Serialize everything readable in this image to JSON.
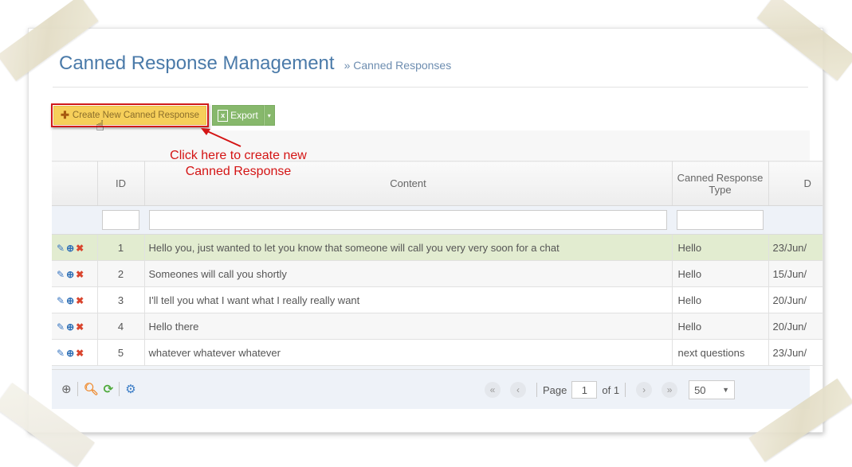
{
  "header": {
    "title": "Canned Response Management",
    "breadcrumb": "» Canned Responses"
  },
  "toolbar": {
    "create_label": "Create New Canned Response",
    "create_icon": "plus-icon",
    "export_label": "Export",
    "export_icon": "excel-icon",
    "export_caret": "▾"
  },
  "annotation": {
    "line1": "Click here to create new",
    "line2": "Canned Response",
    "color": "#d41414"
  },
  "grid": {
    "columns": [
      "",
      "ID",
      "Content",
      "Canned Response Type",
      "D"
    ],
    "rows": [
      {
        "id": "1",
        "content": "Hello you, just wanted to let you know that someone will call you very very soon for a chat",
        "type": "Hello",
        "date": "23/Jun/"
      },
      {
        "id": "2",
        "content": "Someones will call you shortly",
        "type": "Hello",
        "date": "15/Jun/"
      },
      {
        "id": "3",
        "content": "I'll tell you what I want what I really really want",
        "type": "Hello",
        "date": "20/Jun/"
      },
      {
        "id": "4",
        "content": "Hello there",
        "type": "Hello",
        "date": "20/Jun/"
      },
      {
        "id": "5",
        "content": "whatever whatever whatever",
        "type": "next questions",
        "date": "23/Jun/"
      }
    ],
    "row_icons": [
      "edit-icon",
      "view-icon",
      "delete-icon"
    ]
  },
  "pager": {
    "page_label": "Page",
    "page_value": "1",
    "of_label": "of 1",
    "page_size": "50",
    "first": "«",
    "prev": "‹",
    "next": "›",
    "last": "»"
  },
  "colors": {
    "accent": "#4a7aa9",
    "create_button": "#f6cf5a",
    "export_button": "#87b86c",
    "selected_row": "#e2ecd0",
    "link": "#4b7bb2"
  }
}
